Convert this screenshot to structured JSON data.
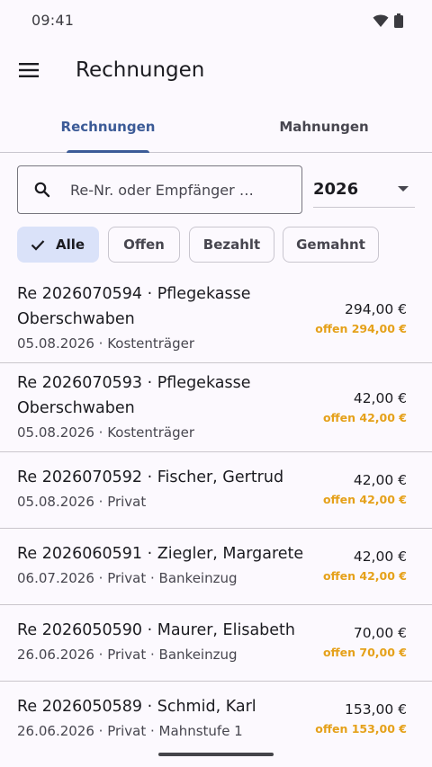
{
  "status": {
    "time": "09:41",
    "icons": [
      "wifi-icon",
      "battery-icon"
    ]
  },
  "app_bar": {
    "menu_icon": "hamburger-menu-icon",
    "title": "Rechnungen"
  },
  "tabs": [
    {
      "label": "Rechnungen",
      "active": true
    },
    {
      "label": "Mahnungen",
      "active": false
    }
  ],
  "search": {
    "placeholder": "Re-Nr. oder Empfänger …",
    "value": "",
    "icon": "search-icon"
  },
  "year_select": {
    "value": "2026"
  },
  "filters": [
    {
      "label": "Alle",
      "selected": true
    },
    {
      "label": "Offen",
      "selected": false
    },
    {
      "label": "Bezahlt",
      "selected": false
    },
    {
      "label": "Gemahnt",
      "selected": false
    }
  ],
  "invoices": [
    {
      "title": "Re 2026070594 · Pflegekasse Oberschwaben",
      "subtitle": "05.08.2026 · Kostenträger",
      "amount": "294,00 €",
      "open": "offen 294,00 €"
    },
    {
      "title": "Re 2026070593 · Pflegekasse Oberschwaben",
      "subtitle": "05.08.2026 · Kostenträger",
      "amount": "42,00 €",
      "open": "offen 42,00 €"
    },
    {
      "title": "Re 2026070592 · Fischer, Gertrud",
      "subtitle": "05.08.2026 · Privat",
      "amount": "42,00 €",
      "open": "offen 42,00 €"
    },
    {
      "title": "Re 2026060591 · Ziegler, Margarete",
      "subtitle": "06.07.2026 · Privat · Bankeinzug",
      "amount": "42,00 €",
      "open": "offen 42,00 €"
    },
    {
      "title": "Re 2026050590 · Maurer, Elisabeth",
      "subtitle": "26.06.2026 · Privat · Bankeinzug",
      "amount": "70,00 €",
      "open": "offen 70,00 €"
    },
    {
      "title": "Re 2026050589 · Schmid, Karl",
      "subtitle": "26.06.2026 · Privat · Mahnstufe 1",
      "amount": "153,00 €",
      "open": "offen 153,00 €"
    }
  ],
  "colors": {
    "accent": "#3c5b97",
    "open_amount": "#e5a11a",
    "chip_selected": "#dae2f9"
  }
}
